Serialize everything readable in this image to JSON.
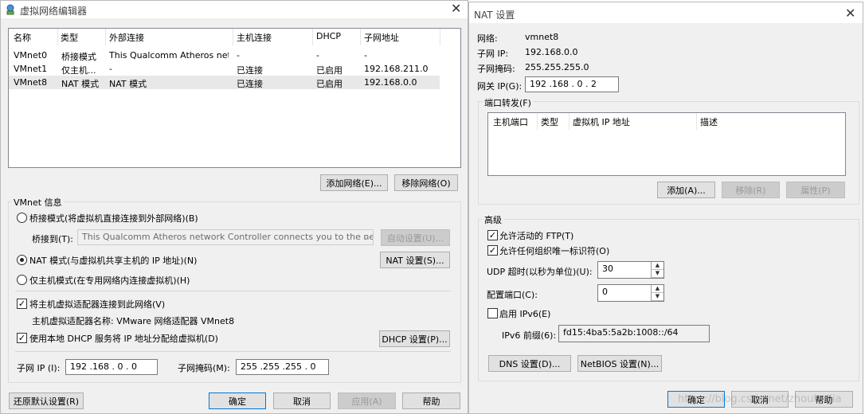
{
  "left_window": {
    "title": "虚拟网络编辑器",
    "columns": [
      "名称",
      "类型",
      "外部连接",
      "主机连接",
      "DHCP",
      "子网地址"
    ],
    "rows": [
      [
        "VMnet0",
        "桥接模式",
        "This Qualcomm Atheros net...",
        "-",
        "-",
        "-"
      ],
      [
        "VMnet1",
        "仅主机...",
        "-",
        "已连接",
        "已启用",
        "192.168.211.0"
      ],
      [
        "VMnet8",
        "NAT 模式",
        "NAT 模式",
        "已连接",
        "已启用",
        "192.168.0.0"
      ]
    ],
    "add_network_button": "添加网络(E)...",
    "remove_network_button": "移除网络(O)",
    "vmnet_info_title": "VMnet 信息",
    "bridge_mode_radio": "桥接模式(将虚拟机直接连接到外部网络)(B)",
    "bridge_to_label": "桥接到(T):",
    "bridge_to_value": "This Qualcomm Atheros network Controller connects you to the network.",
    "auto_settings_button": "自动设置(U)...",
    "nat_mode_radio": "NAT 模式(与虚拟机共享主机的 IP 地址)(N)",
    "nat_settings_button": "NAT 设置(S)...",
    "host_only_radio": "仅主机模式(在专用网络内连接虚拟机)(H)",
    "connect_adapter_checkbox": "将主机虚拟适配器连接到此网络(V)",
    "adapter_name_text": "主机虚拟适配器名称: VMware 网络适配器 VMnet8",
    "use_dhcp_checkbox": "使用本地 DHCP 服务将 IP 地址分配给虚拟机(D)",
    "dhcp_settings_button": "DHCP 设置(P)...",
    "subnet_ip_label": "子网 IP (I):",
    "subnet_ip_value": "192 .168 .  0  .  0",
    "subnet_mask_label": "子网掩码(M):",
    "subnet_mask_value": "255 .255 .255 .  0",
    "restore_defaults_button": "还原默认设置(R)",
    "ok_button": "确定",
    "cancel_button": "取消",
    "apply_button": "应用(A)",
    "help_button": "帮助"
  },
  "right_window": {
    "title": "NAT 设置",
    "network_label": "网络:",
    "network_value": "vmnet8",
    "subnet_ip_label": "子网 IP:",
    "subnet_ip_value": "192.168.0.0",
    "subnet_mask_label": "子网掩码:",
    "subnet_mask_value": "255.255.255.0",
    "gateway_label": "网关 IP(G):",
    "gateway_value": "192 .168 .  0  .  2",
    "port_forwarding_title": "端口转发(F)",
    "pf_columns": [
      "主机端口",
      "类型",
      "虚拟机 IP 地址",
      "描述"
    ],
    "add_button": "添加(A)...",
    "remove_button": "移除(R)",
    "properties_button": "属性(P)",
    "advanced_title": "高级",
    "allow_ftp_checkbox": "允许活动的 FTP(T)",
    "allow_oui_checkbox": "允许任何组织唯一标识符(O)",
    "udp_timeout_label": "UDP 超时(以秒为单位)(U):",
    "udp_timeout_value": "30",
    "config_port_label": "配置端口(C):",
    "config_port_value": "0",
    "enable_ipv6_checkbox": "启用 IPv6(E)",
    "ipv6_prefix_label": "IPv6 前缀(6):",
    "ipv6_prefix_value": "fd15:4ba5:5a2b:1008::/64",
    "dns_settings_button": "DNS 设置(D)...",
    "netbios_settings_button": "NetBIOS 设置(N)...",
    "ok_button": "确定",
    "cancel_button": "取消",
    "help_button": "帮助",
    "watermark": "https://blog.csdn.net/zhouhuijia"
  },
  "icons": {
    "app_icon": "network-globe-icon",
    "close_icon": "close-icon"
  },
  "colors": {
    "window_bg": "#f0f0f0",
    "selected_row": "#e8e8e8",
    "default_button_border": "#0078d7"
  }
}
